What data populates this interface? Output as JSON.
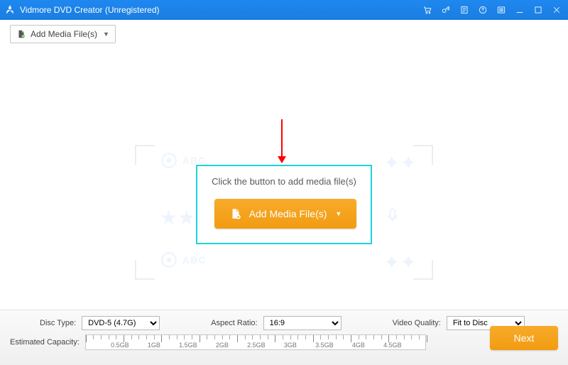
{
  "titlebar": {
    "app_name": "Vidmore DVD Creator (Unregistered)"
  },
  "toolbar": {
    "add_media_label": "Add Media File(s)"
  },
  "main": {
    "hint": "Click the button to add media file(s)",
    "add_media_label": "Add Media File(s)"
  },
  "bottom": {
    "disc_type_label": "Disc Type:",
    "disc_type_value": "DVD-5 (4.7G)",
    "aspect_ratio_label": "Aspect Ratio:",
    "aspect_ratio_value": "16:9",
    "video_quality_label": "Video Quality:",
    "video_quality_value": "Fit to Disc",
    "capacity_label": "Estimated Capacity:",
    "next_label": "Next",
    "ruler_ticks": [
      "0.5GB",
      "1GB",
      "1.5GB",
      "2GB",
      "2.5GB",
      "3GB",
      "3.5GB",
      "4GB",
      "4.5GB"
    ]
  }
}
